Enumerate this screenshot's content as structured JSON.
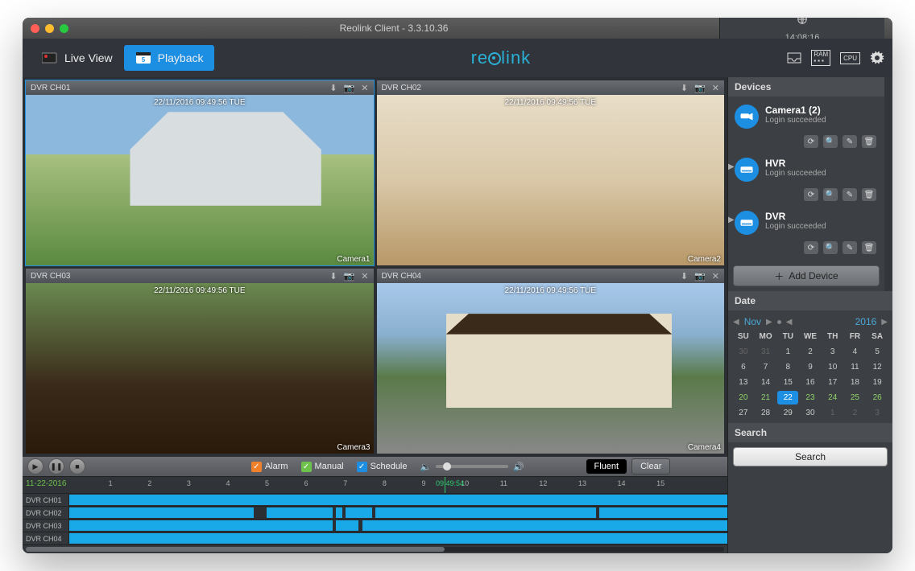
{
  "titlebar": {
    "title": "Reolink Client - 3.3.10.36",
    "clock": "14:08:16"
  },
  "topbar": {
    "live_label": "Live View",
    "playback_label": "Playback",
    "brand": "reolink"
  },
  "tiles": [
    {
      "ch": "DVR CH01",
      "osd": "22/11/2016 09:49:56 TUE",
      "cam": "Camera1"
    },
    {
      "ch": "DVR CH02",
      "osd": "22/11/2016 09:49:56 TUE",
      "cam": "Camera2"
    },
    {
      "ch": "DVR CH03",
      "osd": "22/11/2016 09:49:56 TUE",
      "cam": "Camera3"
    },
    {
      "ch": "DVR CH04",
      "osd": "22/11/2016 09:49:56 TUE",
      "cam": "Camera4"
    }
  ],
  "controls": {
    "alarm": "Alarm",
    "manual": "Manual",
    "schedule": "Schedule",
    "fluent": "Fluent",
    "clear": "Clear"
  },
  "timeline": {
    "date": "11-22-2016",
    "playhead": "09:49:54",
    "hours": [
      "1",
      "2",
      "3",
      "4",
      "5",
      "6",
      "7",
      "8",
      "9",
      "10",
      "11",
      "12",
      "13",
      "14",
      "15"
    ],
    "rows": [
      "DVR CH01",
      "DVR CH02",
      "DVR CH03",
      "DVR CH04"
    ]
  },
  "sidebar": {
    "devices_hdr": "Devices",
    "devices": [
      {
        "name": "Camera1 (2)",
        "status": "Login succeeded",
        "expand": false
      },
      {
        "name": "HVR",
        "status": "Login succeeded",
        "expand": true
      },
      {
        "name": "DVR",
        "status": "Login succeeded",
        "expand": true
      }
    ],
    "add_label": "Add Device",
    "date_hdr": "Date",
    "month": "Nov",
    "year": "2016",
    "dow": [
      "SU",
      "MO",
      "TU",
      "WE",
      "TH",
      "FR",
      "SA"
    ],
    "days": [
      {
        "n": "30",
        "m": true
      },
      {
        "n": "31",
        "m": true
      },
      {
        "n": "1"
      },
      {
        "n": "2"
      },
      {
        "n": "3"
      },
      {
        "n": "4"
      },
      {
        "n": "5"
      },
      {
        "n": "6"
      },
      {
        "n": "7"
      },
      {
        "n": "8"
      },
      {
        "n": "9"
      },
      {
        "n": "10"
      },
      {
        "n": "11"
      },
      {
        "n": "12"
      },
      {
        "n": "13"
      },
      {
        "n": "14"
      },
      {
        "n": "15"
      },
      {
        "n": "16"
      },
      {
        "n": "17"
      },
      {
        "n": "18"
      },
      {
        "n": "19"
      },
      {
        "n": "20",
        "h": true
      },
      {
        "n": "21",
        "h": true
      },
      {
        "n": "22",
        "h": true,
        "s": true
      },
      {
        "n": "23",
        "h": true
      },
      {
        "n": "24",
        "h": true
      },
      {
        "n": "25",
        "h": true
      },
      {
        "n": "26",
        "h": true
      },
      {
        "n": "27"
      },
      {
        "n": "28"
      },
      {
        "n": "29"
      },
      {
        "n": "30"
      },
      {
        "n": "1",
        "m": true
      },
      {
        "n": "2",
        "m": true
      },
      {
        "n": "3",
        "m": true
      }
    ],
    "search_hdr": "Search",
    "search_btn": "Search"
  }
}
